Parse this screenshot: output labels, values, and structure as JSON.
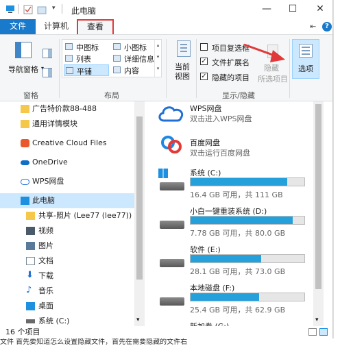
{
  "window": {
    "title": "此电脑",
    "minimize": "—",
    "maximize": "☐",
    "close": "✕"
  },
  "tabs": [
    {
      "label": "文件"
    },
    {
      "label": "计算机"
    },
    {
      "label": "查看"
    }
  ],
  "ribbon": {
    "nav_pane_label": "导航窗格",
    "group_panes": "窗格",
    "layout_items": [
      "中图标",
      "小图标",
      "列表",
      "详细信息",
      "平铺",
      "内容"
    ],
    "group_layout": "布局",
    "current_view_label": "当前视图",
    "checkboxes": [
      {
        "label": "项目复选框",
        "checked": false
      },
      {
        "label": "文件扩展名",
        "checked": true
      },
      {
        "label": "隐藏的项目",
        "checked": true
      }
    ],
    "hide_label": "隐藏",
    "selected_items_label": "所选项目",
    "group_show_hide": "显示/隐藏",
    "options_label": "选项"
  },
  "nav": {
    "items": [
      {
        "label": "广告特价款88-488"
      },
      {
        "label": "通用详情模块"
      },
      {
        "label": "Creative Cloud Files"
      },
      {
        "label": "OneDrive"
      },
      {
        "label": "WPS网盘"
      },
      {
        "label": "此电脑"
      },
      {
        "label": "共享-照片 (Lee77 (lee77))"
      },
      {
        "label": "视频"
      },
      {
        "label": "图片"
      },
      {
        "label": "文档"
      },
      {
        "label": "下载"
      },
      {
        "label": "音乐"
      },
      {
        "label": "桌面"
      },
      {
        "label": "系统 (C:)"
      }
    ]
  },
  "content": {
    "clouds": [
      {
        "name": "WPS网盘",
        "sub": "双击进入WPS网盘"
      },
      {
        "name": "百度网盘",
        "sub": "双击运行百度网盘"
      }
    ],
    "drives": [
      {
        "name": "系统 (C:)",
        "info": "16.4 GB 可用，共 111 GB",
        "used": 0.85
      },
      {
        "name": "小白一键重装系统 (D:)",
        "info": "7.78 GB 可用，共 80.0 GB",
        "used": 0.9
      },
      {
        "name": "软件 (E:)",
        "info": "28.1 GB 可用，共 73.0 GB",
        "used": 0.62
      },
      {
        "name": "本地磁盘 (F:)",
        "info": "25.4 GB 可用，共 62.9 GB",
        "used": 0.6
      },
      {
        "name": "新加卷 (G:)",
        "info": "",
        "used": 0
      }
    ]
  },
  "status": {
    "count": "16 个项目"
  },
  "bg_text": "文件 首先要知道怎么设置隐藏文件，首先在需要隐藏的文件右"
}
